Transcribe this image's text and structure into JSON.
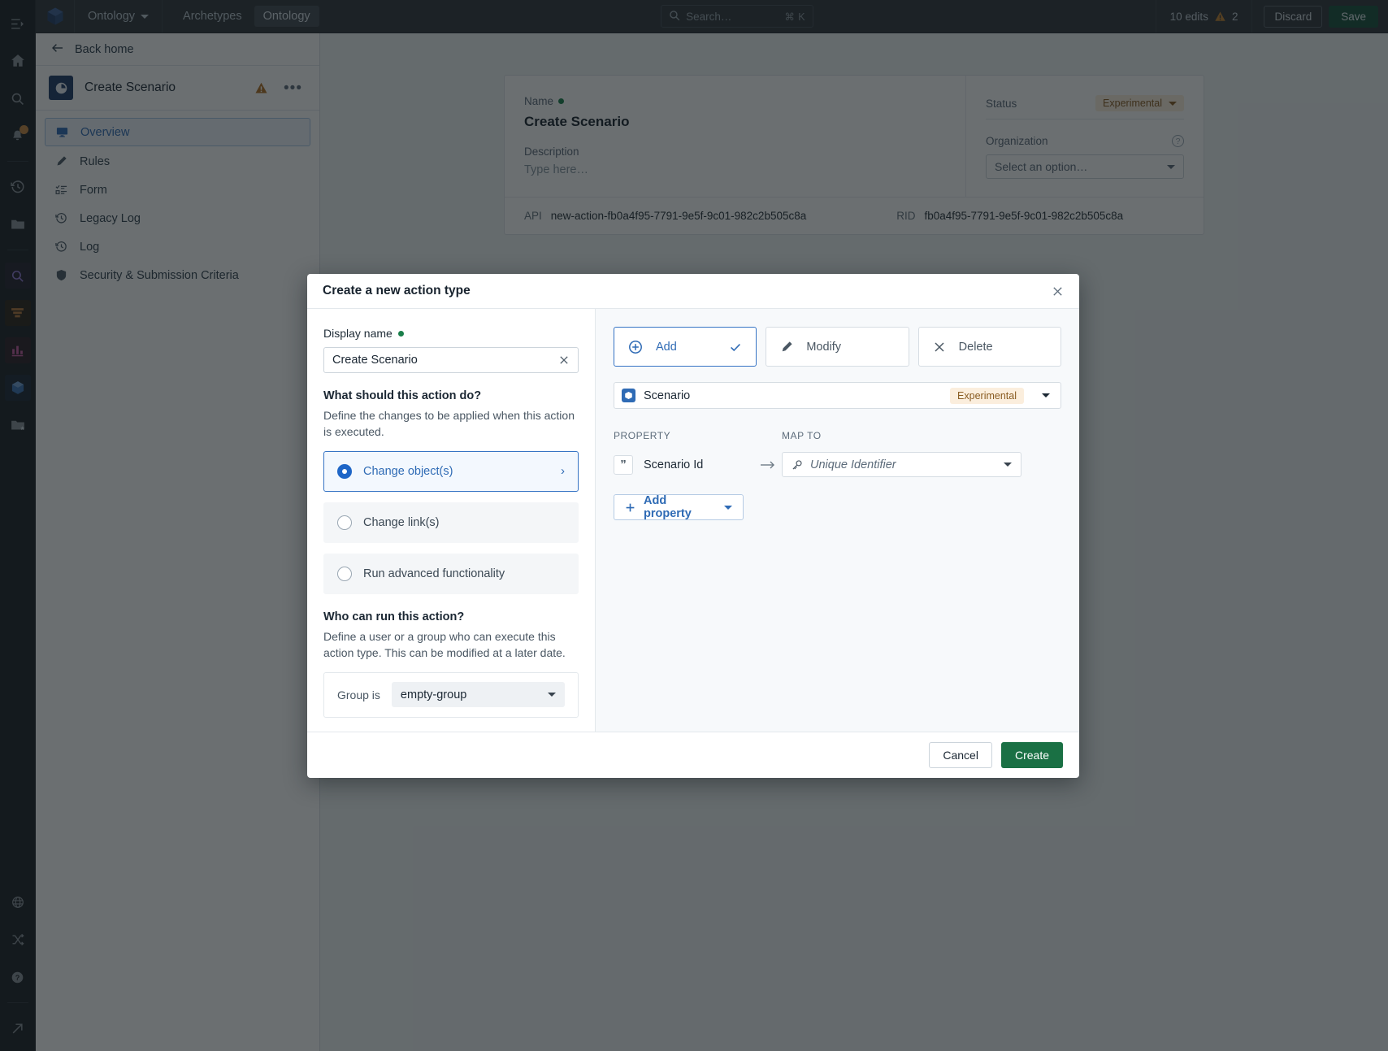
{
  "topbar": {
    "logo_icon": "cube-icon",
    "product_label": "Ontology",
    "tabs": [
      {
        "label": "Archetypes",
        "active": false
      },
      {
        "label": "Ontology",
        "active": true
      }
    ],
    "search": {
      "placeholder": "Search…",
      "shortcut": "⌘ K",
      "icon": "search-icon"
    },
    "edits_label": "10 edits",
    "warning_count": "2",
    "discard_label": "Discard",
    "save_label": "Save"
  },
  "rail": {
    "items": [
      {
        "name": "collapse-panel-icon"
      },
      {
        "name": "home-icon"
      },
      {
        "name": "search-icon"
      },
      {
        "name": "notifications-icon",
        "badge": true
      },
      {
        "name": "history-icon"
      },
      {
        "name": "folder-icon"
      },
      {
        "name": "object-explorer-icon"
      },
      {
        "name": "pipeline-icon"
      },
      {
        "name": "charts-icon"
      },
      {
        "name": "ontology-cube-icon"
      },
      {
        "name": "saved-folder-icon"
      },
      {
        "name": "globe-icon"
      },
      {
        "name": "shuffle-icon"
      },
      {
        "name": "help-icon"
      },
      {
        "name": "open-external-icon"
      }
    ]
  },
  "sidebar": {
    "back_label": "Back home",
    "entity_name": "Create Scenario",
    "more_label": "•••",
    "items": [
      {
        "label": "Overview",
        "icon": "monitor-icon",
        "active": true
      },
      {
        "label": "Rules",
        "icon": "pencil-icon",
        "active": false
      },
      {
        "label": "Form",
        "icon": "form-icon",
        "active": false
      },
      {
        "label": "Legacy Log",
        "icon": "history-icon",
        "active": false
      },
      {
        "label": "Log",
        "icon": "history-icon",
        "active": false
      },
      {
        "label": "Security & Submission Criteria",
        "icon": "shield-icon",
        "active": false
      }
    ]
  },
  "main_card": {
    "name_label": "Name",
    "name_value": "Create Scenario",
    "description_label": "Description",
    "description_placeholder": "Type here…",
    "status_label": "Status",
    "status_value": "Experimental",
    "organization_label": "Organization",
    "organization_placeholder": "Select an option…",
    "api_label": "API",
    "api_value": "new-action-fb0a4f95-7791-9e5f-9c01-982c2b505c8a",
    "rid_label": "RID",
    "rid_value": "fb0a4f95-7791-9e5f-9c01-982c2b505c8a"
  },
  "modal": {
    "title": "Create a new action type",
    "close_icon": "close-icon",
    "display_name_label": "Display name",
    "display_name_value": "Create Scenario",
    "clear_icon": "clear-icon",
    "question_label": "What should this action do?",
    "question_help": "Define the changes to be applied when this action is executed.",
    "options": [
      {
        "label": "Change object(s)",
        "selected": true,
        "chevron": "›"
      },
      {
        "label": "Change link(s)",
        "selected": false,
        "chevron": ""
      },
      {
        "label": "Run advanced functionality",
        "selected": false,
        "chevron": ""
      }
    ],
    "who_label": "Who can run this action?",
    "who_help": "Define a user or a group who can execute this action type. This can be modified at a later date.",
    "group_label": "Group is",
    "group_value": "empty-group",
    "segments": [
      {
        "label": "Add",
        "icon": "plus-circle-icon",
        "active": true
      },
      {
        "label": "Modify",
        "icon": "pencil-icon",
        "active": false
      },
      {
        "label": "Delete",
        "icon": "close-icon",
        "active": false
      }
    ],
    "object_type": "Scenario",
    "object_badge": "Experimental",
    "column_property": "PROPERTY",
    "column_map_to": "MAP TO",
    "properties": [
      {
        "name": "Scenario Id",
        "icon": "string-quote-icon",
        "map_to_placeholder": "Unique Identifier",
        "map_to_icon": "key-icon"
      }
    ],
    "add_property_label": "Add property",
    "cancel_label": "Cancel",
    "create_label": "Create"
  },
  "colors": {
    "accent_blue": "#2f6bb5",
    "create_green": "#1a7044",
    "save_green": "#17503a",
    "badge_amber_bg": "#fbeedd",
    "badge_amber_fg": "#8a5c22",
    "topbar_bg": "#30363c",
    "rail_bg": "#1c2127"
  }
}
